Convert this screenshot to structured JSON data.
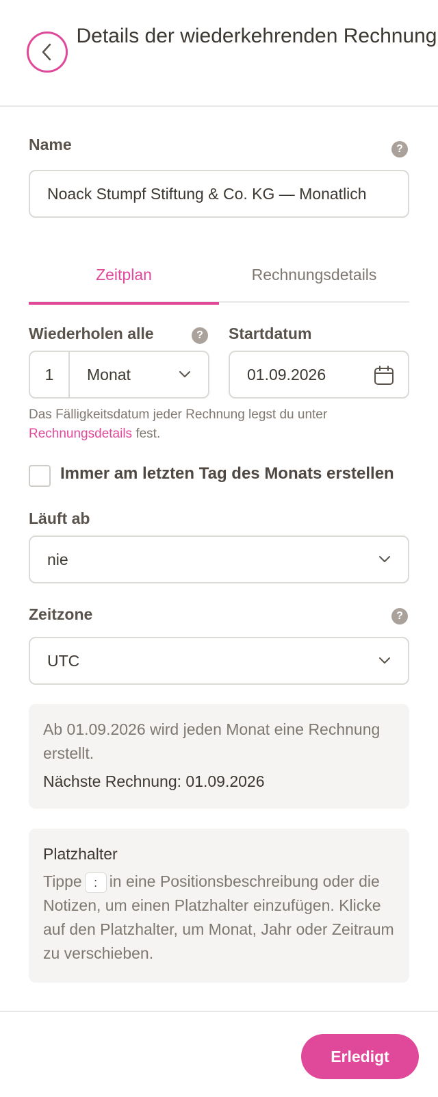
{
  "header": {
    "title": "Details der wiederkehrenden Rechnung"
  },
  "name_section": {
    "label": "Name",
    "value": "Noack Stumpf Stiftung & Co. KG — Monatlich"
  },
  "tabs": [
    {
      "label": "Zeitplan",
      "active": true
    },
    {
      "label": "Rechnungsdetails",
      "active": false
    }
  ],
  "repeat": {
    "label": "Wiederholen alle",
    "count": "1",
    "unit": "Monat"
  },
  "start": {
    "label": "Startdatum",
    "value": "01.09.2026"
  },
  "hint": {
    "text_before": "Das Fälligkeitsdatum jeder Rechnung legst du unter",
    "link": "Rechnungsdetails",
    "text_after": "fest."
  },
  "last_day": {
    "label": "Immer am letzten Tag des Monats erstellen",
    "checked": false
  },
  "expires": {
    "label": "Läuft ab",
    "value": "nie"
  },
  "timezone": {
    "label": "Zeitzone",
    "value": "UTC"
  },
  "summary": {
    "line1": "Ab 01.09.2026 wird jeden Monat eine Rechnung erstellt.",
    "line2": "Nächste Rechnung: 01.09.2026"
  },
  "placeholder": {
    "title": "Platzhalter",
    "text_before": "Tippe",
    "key": ":",
    "text_after": "in eine Positionsbeschreibung oder die Notizen, um einen Platzhalter einzufügen. Klicke auf den Platzhalter, um Monat, Jahr oder Zeitraum zu verschieben."
  },
  "footer": {
    "done_label": "Erledigt"
  },
  "colors": {
    "accent": "#e0489a",
    "help_icon": "#aaa29a",
    "box_bg": "#f5f4f2",
    "border": "#dcdad7"
  },
  "icons": {
    "back": "chevron-left-icon",
    "help": "question-mark-icon",
    "dropdown": "chevron-down-icon",
    "calendar": "calendar-icon"
  }
}
